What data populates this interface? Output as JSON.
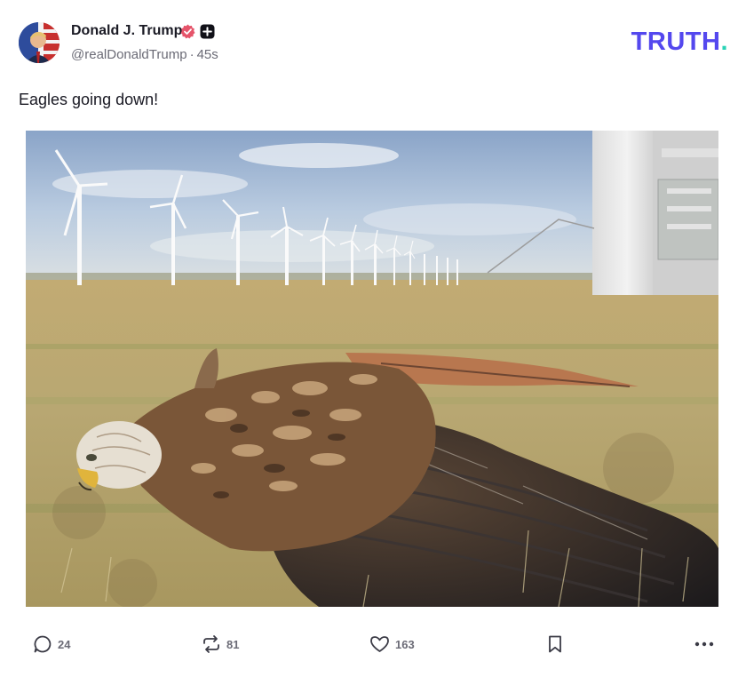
{
  "post": {
    "author": {
      "display_name": "Donald J. Trump",
      "handle": "@realDonaldTrump",
      "time_ago": "45s",
      "verified_icon": "verified-badge-icon",
      "plus_icon": "plus-badge-icon"
    },
    "brand": {
      "name": "TRUTH",
      "dot": "."
    },
    "text": "Eagles going down!",
    "media": {
      "description_icon": "photo-dead-bird-wind-turbines"
    },
    "actions": {
      "reply_count": "24",
      "retruth_count": "81",
      "like_count": "163"
    }
  },
  "colors": {
    "brand": "#5448ee",
    "brand_dot": "#2ad3b6",
    "verified": "#e5546a",
    "muted": "#6b6b76"
  }
}
